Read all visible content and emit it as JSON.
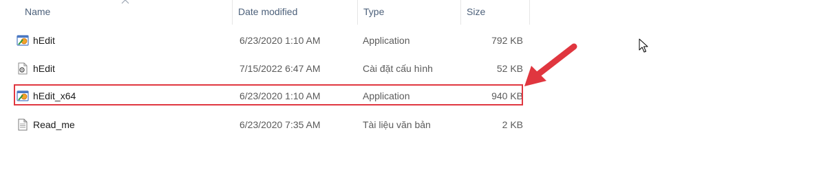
{
  "columns": {
    "name": "Name",
    "date": "Date modified",
    "type": "Type",
    "size": "Size"
  },
  "files": [
    {
      "name": "hEdit",
      "date": "6/23/2020 1:10 AM",
      "type": "Application",
      "size": "792 KB",
      "icon": "application-icon"
    },
    {
      "name": "hEdit",
      "date": "7/15/2022 6:47 AM",
      "type": "Cài đặt cấu hình",
      "size": "52 KB",
      "icon": "config-settings-icon"
    },
    {
      "name": "hEdit_x64",
      "date": "6/23/2020 1:10 AM",
      "type": "Application",
      "size": "940 KB",
      "icon": "application-icon"
    },
    {
      "name": "Read_me",
      "date": "6/23/2020 7:35 AM",
      "type": "Tài liệu văn bản",
      "size": "2 KB",
      "icon": "text-document-icon"
    }
  ],
  "colors": {
    "highlight": "#e0363f",
    "arrow": "#e0363f",
    "header_text": "#4c607a"
  }
}
